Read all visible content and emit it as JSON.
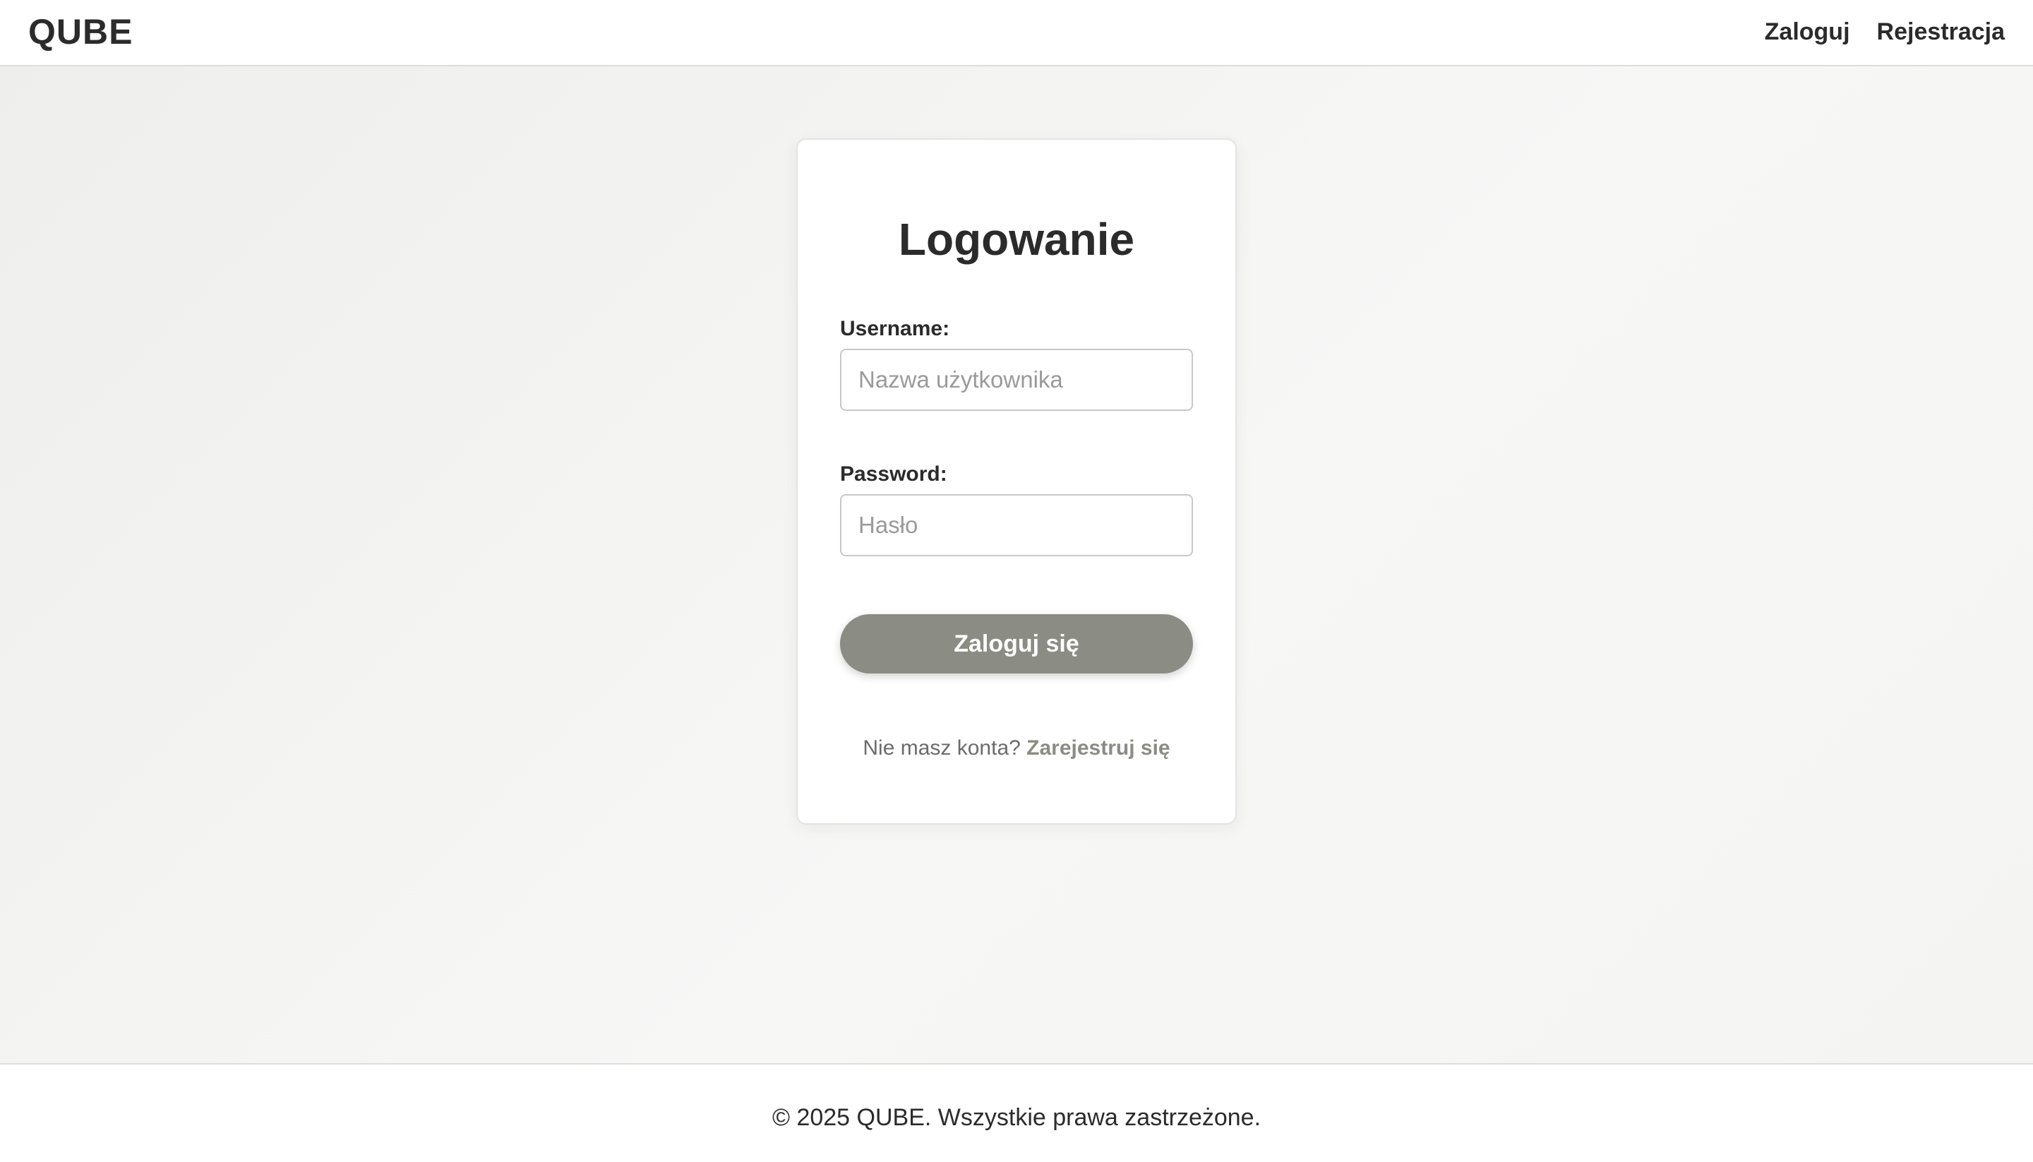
{
  "header": {
    "brand": "QUBE",
    "nav": {
      "login": "Zaloguj",
      "register": "Rejestracja"
    }
  },
  "login_card": {
    "title": "Logowanie",
    "username": {
      "label": "Username:",
      "placeholder": "Nazwa użytkownika",
      "value": ""
    },
    "password": {
      "label": "Password:",
      "placeholder": "Hasło",
      "value": ""
    },
    "submit_label": "Zaloguj się",
    "register_prompt": "Nie masz konta?",
    "register_link": "Zarejestruj się"
  },
  "footer": {
    "copyright": "© 2025 QUBE. Wszystkie prawa zastrzeżone."
  },
  "colors": {
    "accent": "#8b8c83",
    "text": "#2b2b2b",
    "background": "#f4f4f2",
    "surface": "#ffffff"
  }
}
